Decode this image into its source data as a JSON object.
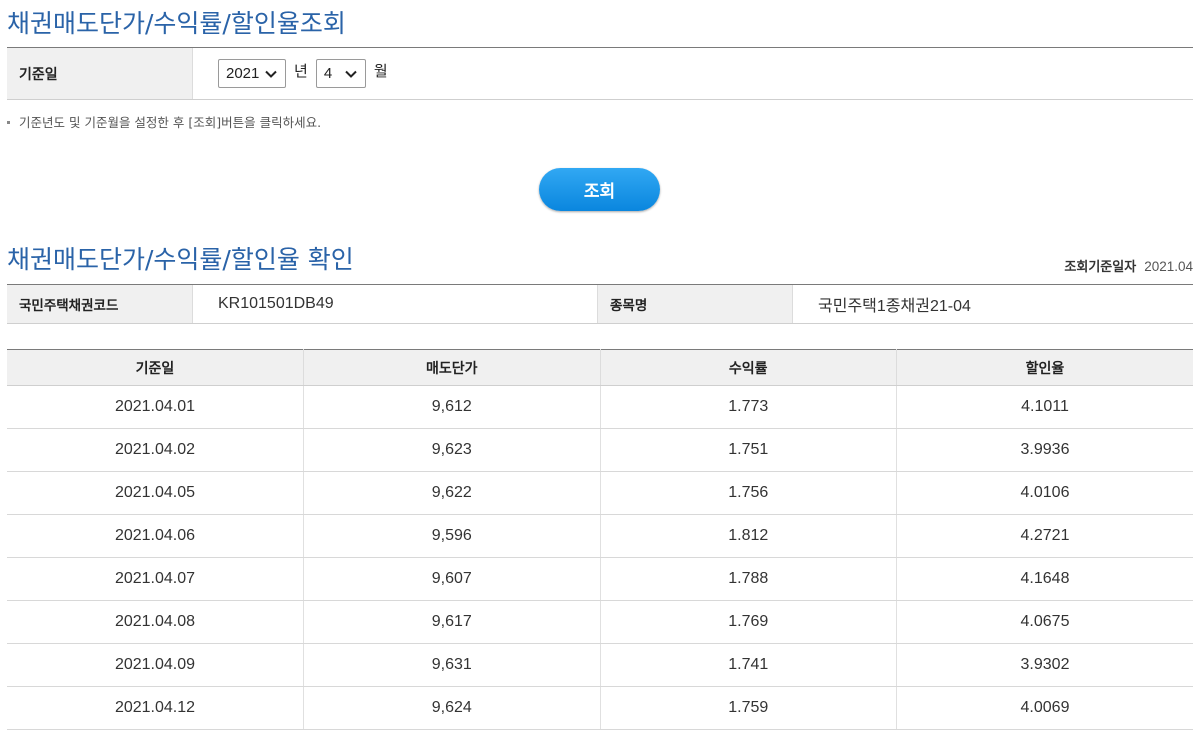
{
  "lookup": {
    "title": "채권매도단가/수익률/할인율조회",
    "base_date_label": "기준일",
    "year_value": "2021",
    "year_unit": "년",
    "month_value": "4",
    "month_unit": "월",
    "note": "기준년도 및 기준월을 설정한 후 [조회]버튼을 클릭하세요.",
    "search_button": "조회"
  },
  "result": {
    "title": "채권매도단가/수익률/할인율 확인",
    "ref_date_label": "조회기준일자",
    "ref_date_value": "2021.04",
    "bond_code_label": "국민주택채권코드",
    "bond_code_value": "KR101501DB49",
    "item_name_label": "종목명",
    "item_name_value": "국민주택1종채권21-04",
    "columns": [
      "기준일",
      "매도단가",
      "수익률",
      "할인율"
    ],
    "rows": [
      [
        "2021.04.01",
        "9,612",
        "1.773",
        "4.1011"
      ],
      [
        "2021.04.02",
        "9,623",
        "1.751",
        "3.9936"
      ],
      [
        "2021.04.05",
        "9,622",
        "1.756",
        "4.0106"
      ],
      [
        "2021.04.06",
        "9,596",
        "1.812",
        "4.2721"
      ],
      [
        "2021.04.07",
        "9,607",
        "1.788",
        "4.1648"
      ],
      [
        "2021.04.08",
        "9,617",
        "1.769",
        "4.0675"
      ],
      [
        "2021.04.09",
        "9,631",
        "1.741",
        "3.9302"
      ],
      [
        "2021.04.12",
        "9,624",
        "1.759",
        "4.0069"
      ]
    ]
  },
  "colors": {
    "title": "#2a63a8",
    "button": "#1a94e8",
    "header_bg": "#f0f0f0"
  },
  "icons": {
    "select_arrow": "chevron-down-icon",
    "note_marker": "bullet-icon"
  }
}
